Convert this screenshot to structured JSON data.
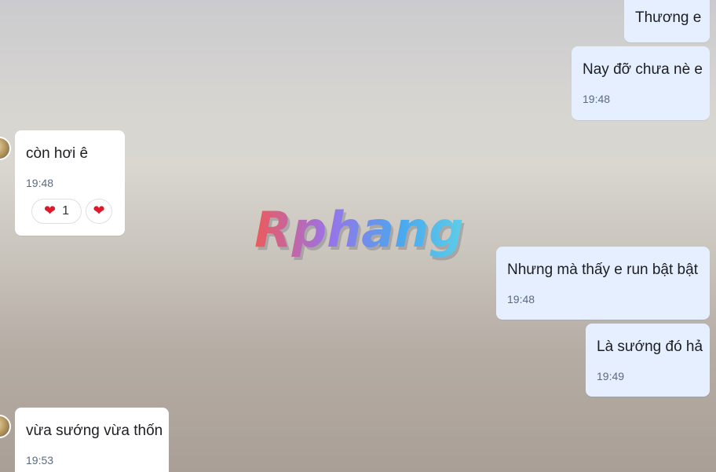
{
  "messages": [
    {
      "text": "Thương e",
      "time": ""
    },
    {
      "text": "Nay đỡ chưa nè e",
      "time": "19:48"
    },
    {
      "text": "còn hơi ê",
      "time": "19:48"
    },
    {
      "text": "Nhưng mà thấy e run bật bật",
      "time": "19:48"
    },
    {
      "text": "Là sướng đó hả",
      "time": "19:49"
    },
    {
      "text": "vừa sướng vừa thốn",
      "time": "19:53"
    }
  ],
  "reaction": {
    "emoji": "❤",
    "count": "1",
    "add_emoji": "❤"
  },
  "watermark": {
    "text": "Rphang"
  },
  "colors": {
    "outgoing_bubble": "#e5efff",
    "incoming_bubble": "#ffffff",
    "time_text": "#5a6a80",
    "heart": "#e0182b"
  }
}
